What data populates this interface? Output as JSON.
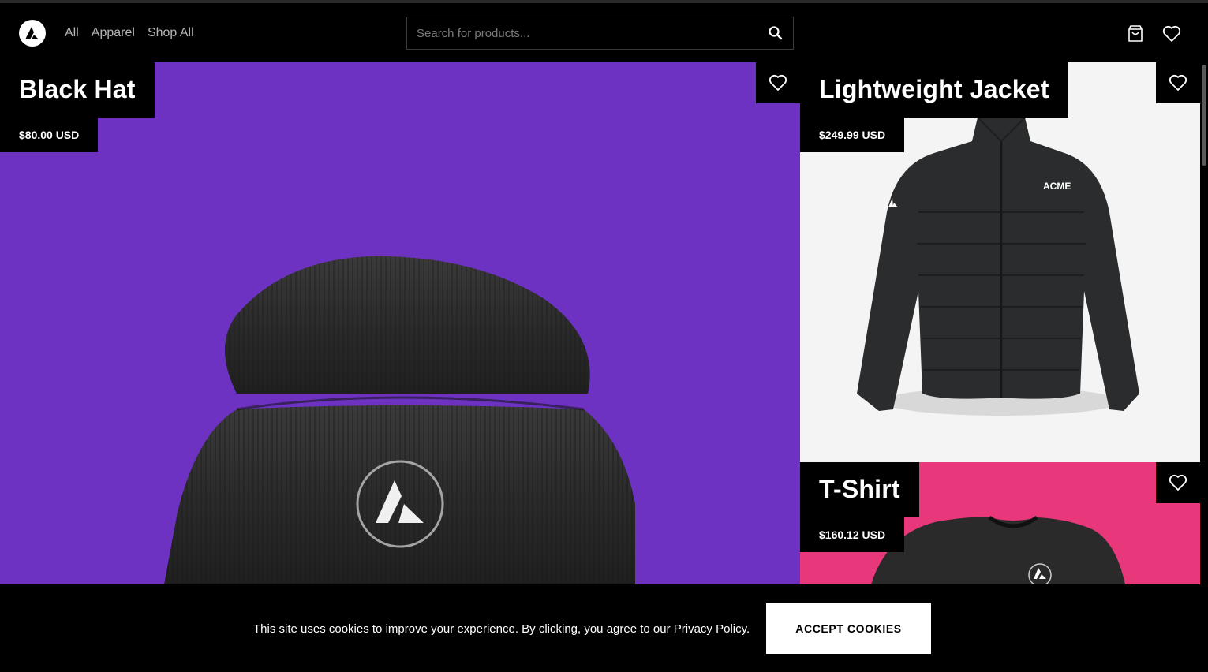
{
  "header": {
    "logo_icon": "acme-triangle-logo",
    "nav": [
      {
        "label": "All"
      },
      {
        "label": "Apparel"
      },
      {
        "label": "Shop All"
      }
    ],
    "search": {
      "placeholder": "Search for products...",
      "icon": "search-icon"
    },
    "cart_icon": "cart-bag-icon",
    "wishlist_icon": "heart-icon"
  },
  "products": {
    "hat": {
      "name": "Black Hat",
      "price": "$80.00 USD",
      "bg": "#6e32c2"
    },
    "jacket": {
      "name": "Lightweight Jacket",
      "price": "$249.99 USD",
      "bg": "#f4f4f4",
      "brand_text": "ACME"
    },
    "shirt": {
      "name": "T-Shirt",
      "price": "$160.12 USD",
      "bg": "#e9377b"
    }
  },
  "cookie_banner": {
    "text": "This site uses cookies to improve your experience. By clicking, you agree to our Privacy Policy.",
    "button_label": "ACCEPT COOKIES"
  }
}
